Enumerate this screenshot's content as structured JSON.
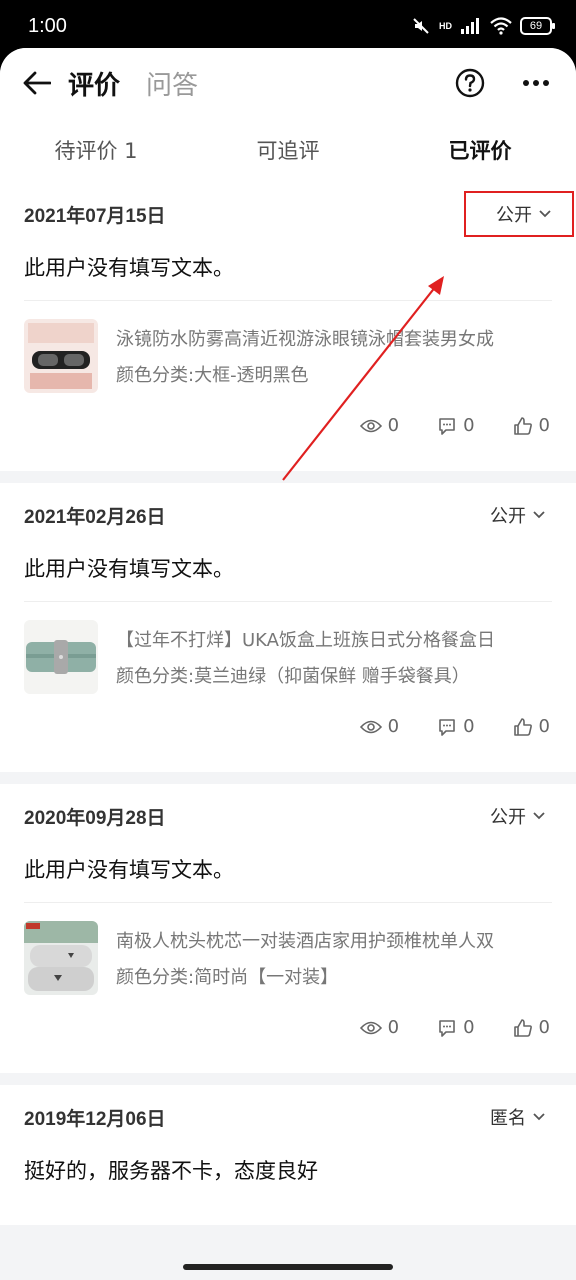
{
  "statusbar": {
    "time": "1:00",
    "network": "HD",
    "battery": "69"
  },
  "header": {
    "tabs": [
      {
        "label": "评价"
      },
      {
        "label": "问答"
      }
    ]
  },
  "tabs": [
    {
      "label": "待评价 1"
    },
    {
      "label": "可追评"
    },
    {
      "label": "已评价"
    }
  ],
  "reviews": [
    {
      "date": "2021年07月15日",
      "visibility": "公开",
      "text": "此用户没有填写文本。",
      "product": {
        "title": "泳镜防水防雾高清近视游泳眼镜泳帽套装男女成",
        "sku": "颜色分类:大框-透明黑色"
      },
      "stats": {
        "views": "0",
        "comments": "0",
        "likes": "0"
      }
    },
    {
      "date": "2021年02月26日",
      "visibility": "公开",
      "text": "此用户没有填写文本。",
      "product": {
        "title": "【过年不打烊】UKA饭盒上班族日式分格餐盒日",
        "sku": "颜色分类:莫兰迪绿（抑菌保鲜 赠手袋餐具）"
      },
      "stats": {
        "views": "0",
        "comments": "0",
        "likes": "0"
      }
    },
    {
      "date": "2020年09月28日",
      "visibility": "公开",
      "text": "此用户没有填写文本。",
      "product": {
        "title": "南极人枕头枕芯一对装酒店家用护颈椎枕单人双",
        "sku": "颜色分类:简时尚【一对装】"
      },
      "stats": {
        "views": "0",
        "comments": "0",
        "likes": "0"
      }
    },
    {
      "date": "2019年12月06日",
      "visibility": "匿名",
      "text": "挺好的，服务器不卡，态度良好"
    }
  ],
  "colors": {
    "accent": "#e02020",
    "muted": "#777777"
  }
}
